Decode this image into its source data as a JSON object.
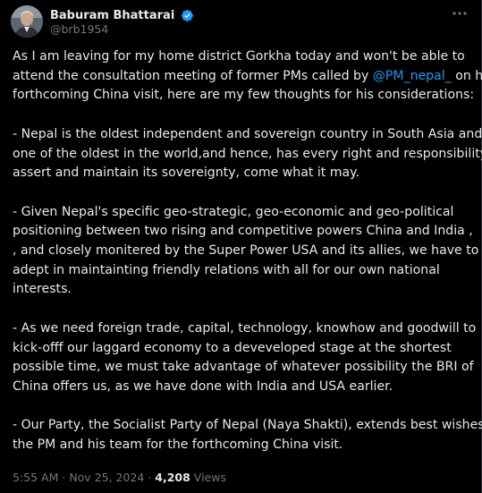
{
  "author": {
    "name": "Baburam Bhattarai",
    "handle": "@brb1954",
    "verified": true,
    "avatar": "avatar-photo",
    "verified_icon": "verified-badge-icon",
    "more_icon": "more-options-icon"
  },
  "tweet": {
    "lines": [
      "As I am leaving for my home district Gorkha today and won't be able to",
      "attend the consultation meeting of former PMs called by ",
      "forthcoming China visit, here are my few  thoughts for his considerations:",
      "- Nepal is the oldest independent and sovereign country in South Asia and",
      "one of the oldest in the world,and hence, has every right and responsibility to",
      "assert and maintain its sovereignty, come what it may.",
      "- Given Nepal's specific geo-strategic, geo-economic and geo-political",
      "positioning between two rising and competitive powers China and India ,",
      ", and closely monitered by the Super Power USA and its allies, we have to be",
      "adept in maintainting  friendly relations with all for our own national",
      "interests.",
      "- As we need foreign trade, capital, technology, knowhow and goodwill to",
      "kick-offf our laggard  economy to a deveveloped stage at the shortest",
      "possible time, we must take advantage of whatever possibility the BRI of",
      "China offers us, as we have done with India and USA earlier.",
      "- Our Party, the Socialist Party of Nepal (Naya Shakti), extends best wishes to",
      "the PM and his team for the forthcoming China visit."
    ],
    "mention": "@PM_nepal_",
    "mention_suffix": "  on his"
  },
  "meta": {
    "time": "5:55 AM",
    "separator1": " · ",
    "date": "Nov 25, 2024",
    "separator2": " · ",
    "views_count": "4,208",
    "views_label": " Views"
  },
  "colors": {
    "background": "#000000",
    "text": "#e7e9ea",
    "secondary": "#71767b",
    "link": "#1d9bf0",
    "verified": "#1d9bf0"
  }
}
